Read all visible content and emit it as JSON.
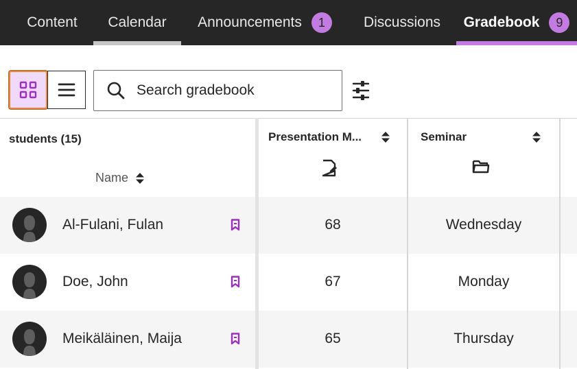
{
  "nav": {
    "tabs": [
      {
        "label": "Content"
      },
      {
        "label": "Calendar"
      },
      {
        "label": "Announcements",
        "badge": "1"
      },
      {
        "label": "Discussions"
      },
      {
        "label": "Gradebook",
        "badge": "9"
      }
    ],
    "active_tab": "Gradebook"
  },
  "toolbar": {
    "grid_view_icon": "grid-icon",
    "list_view_icon": "list-icon",
    "search_placeholder": "Search gradebook",
    "filter_icon": "filter-sliders-icon"
  },
  "table": {
    "students_title": "students (15)",
    "name_header": "Name",
    "columns": [
      {
        "label": "Presentation M...",
        "icon": "assignment-icon"
      },
      {
        "label": "Seminar",
        "icon": "folder-icon"
      }
    ],
    "rows": [
      {
        "name": "Al-Fulani, Fulan",
        "c1": "68",
        "c2": "Wednesday"
      },
      {
        "name": "Doe, John",
        "c1": "67",
        "c2": "Monday"
      },
      {
        "name": "Meikäläinen, Maija",
        "c1": "65",
        "c2": "Thursday"
      }
    ]
  },
  "colors": {
    "nav_bg": "#262626",
    "accent_purple": "#c27be0",
    "bookmark_purple": "#9b2fbf",
    "grid_active_bg": "#f1daf9",
    "focus_orange": "#e8833a"
  }
}
